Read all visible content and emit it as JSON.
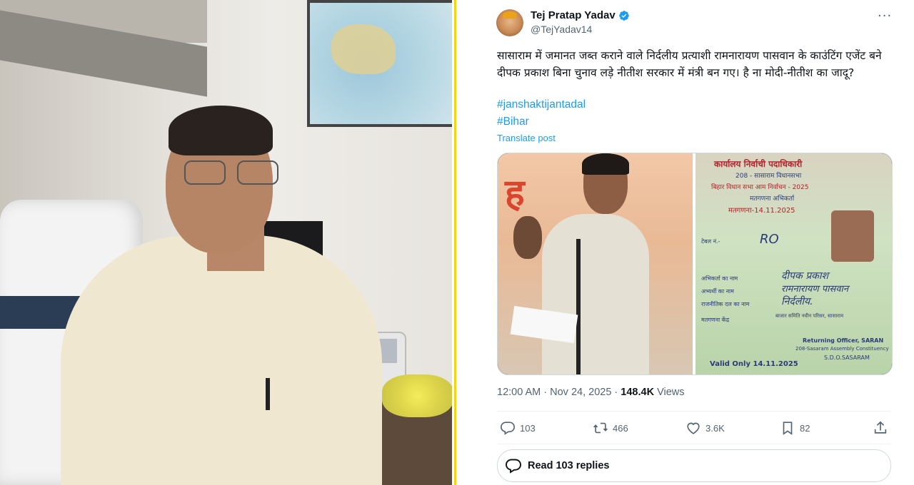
{
  "tweet": {
    "author_name": "Tej Pratap Yadav",
    "author_handle": "@TejYadav14",
    "text": "सासाराम में जमानत जब्त कराने वाले निर्दलीय प्रत्याशी रामनारायण पासवान के काउंटिंग एजेंट बने दीपक प्रकाश बिना चुनाव लड़े नीतीश सरकार में मंत्री बन गए। है ना मोदी-नीतीश का जादू?",
    "hashtags": [
      "#janshaktijantadal",
      "#Bihar"
    ],
    "translate_label": "Translate post",
    "timestamp": "12:00 AM · Nov 24, 2025 · ",
    "views_count": "148.4K",
    "views_label": " Views",
    "replies": "103",
    "reposts": "466",
    "likes": "3.6K",
    "bookmarks": "82",
    "read_replies_label": "Read 103 replies",
    "more_label": "···"
  },
  "media": {
    "left_sign_text": "ह",
    "card_lines": [
      "कार्यालय निर्वाची पदाधिकारी",
      "208 - सासाराम विधानसभा",
      "बिहार विधान सभा आम निर्वाचन - 2025",
      "मतगणना अभिकर्ता",
      "मतगणना-14.11.2025",
      "टेबल नं.-",
      "RO",
      "अभिकर्ता का नाम",
      "दीपक प्रकाश",
      "अभ्यर्थी का नाम",
      "रामनारायण पासवान",
      "राजनीतिक दल का नाम",
      "निर्दलीय.",
      "मतगणना केंद्र",
      "बाजार समिति नवीन परिसर, सासाराम",
      "Returning Officer, SARAN",
      "208-Sasaram Assembly Constituency",
      "S.D.O.SASARAM",
      "Valid Only 14.11.2025"
    ]
  },
  "colors": {
    "accent": "#1d9bf0",
    "text": "#0f1419",
    "muted": "#536471",
    "divider_yellow": "#f2d614"
  }
}
